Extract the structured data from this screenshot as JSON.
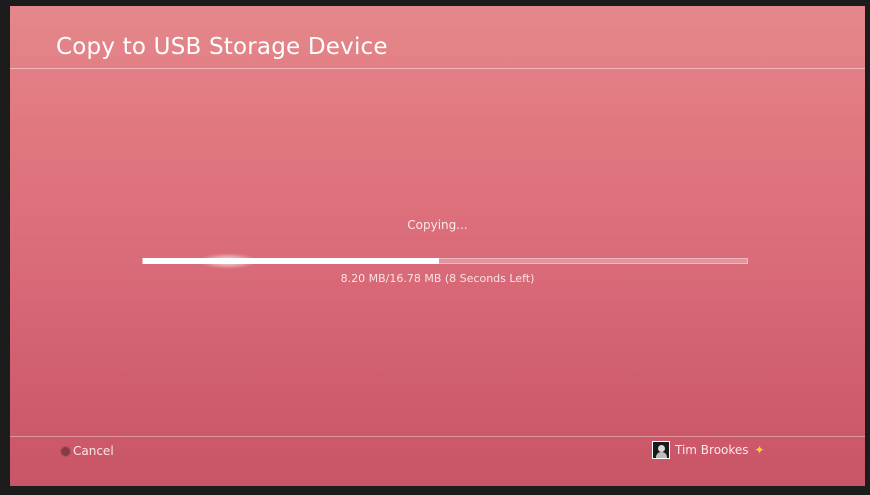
{
  "screen": {
    "title": "Copy to USB Storage Device"
  },
  "copy": {
    "status": "Copying...",
    "size_info": "8.20 MB/16.78 MB (8 Seconds Left)",
    "progress_percent": 49
  },
  "footer": {
    "cancel_label": "Cancel",
    "cancel_icon": "circle-button-icon",
    "user_name": "Tim Brookes",
    "avatar_icon": "avatar-icon",
    "plus_icon": "playstation-plus-icon",
    "plus_glyph": "✦",
    "plus_color": "#ffd23a"
  },
  "colors": {
    "background_top": "#e4888c",
    "background_bottom": "#c95567",
    "progress_fill": "#ffffff"
  }
}
